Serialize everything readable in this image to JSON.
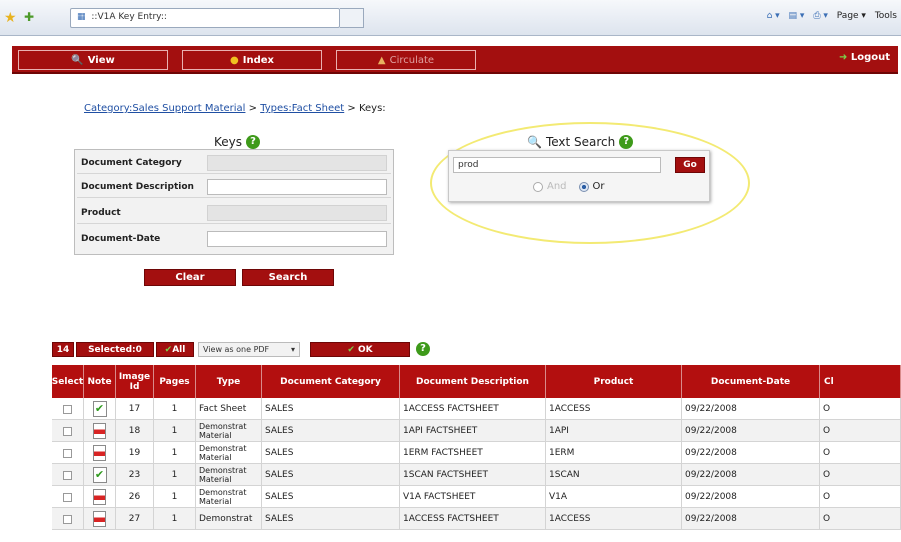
{
  "browser": {
    "tab_title": "::V1A Key Entry::",
    "commands": [
      "Page ▾",
      "Tools"
    ]
  },
  "nav": {
    "view": "View",
    "index": "Index",
    "circulate": "Circulate",
    "logout": "Logout"
  },
  "breadcrumb": {
    "category": "Category:Sales Support Material",
    "sep1": " > ",
    "type": "Types:Fact Sheet",
    "sep2": " > Keys:"
  },
  "keys": {
    "title": "Keys",
    "fields": [
      {
        "label": "Document Category",
        "value": "",
        "disabled": true
      },
      {
        "label": "Document Description",
        "value": "",
        "disabled": false
      },
      {
        "label": "Product",
        "value": "",
        "disabled": true
      },
      {
        "label": "Document-Date",
        "value": "",
        "disabled": false
      }
    ],
    "clear_label": "Clear",
    "search_label": "Search"
  },
  "text_search": {
    "title": "Text Search",
    "query": "prod",
    "go_label": "Go",
    "and_label": "And",
    "or_label": "Or",
    "selected": "or"
  },
  "results_toolbar": {
    "count": "14",
    "selected": "Selected:0",
    "all": "All",
    "view_mode": "View as one PDF",
    "ok": "OK"
  },
  "table": {
    "headers": [
      "Select",
      "Note",
      "Image Id",
      "Pages",
      "Type",
      "Document Category",
      "Document Description",
      "Product",
      "Document-Date",
      "Cl"
    ],
    "rows": [
      {
        "note": "check",
        "image_id": "17",
        "pages": "1",
        "type": "Fact Sheet",
        "category": "SALES",
        "description": "1ACCESS FACTSHEET",
        "product": "1ACCESS",
        "date": "09/22/2008",
        "cl": "O"
      },
      {
        "note": "pdf",
        "image_id": "18",
        "pages": "1",
        "type": "Demonstrat Material",
        "category": "SALES",
        "description": "1API FACTSHEET",
        "product": "1API",
        "date": "09/22/2008",
        "cl": "O"
      },
      {
        "note": "pdf",
        "image_id": "19",
        "pages": "1",
        "type": "Demonstrat Material",
        "category": "SALES",
        "description": "1ERM FACTSHEET",
        "product": "1ERM",
        "date": "09/22/2008",
        "cl": "O"
      },
      {
        "note": "check",
        "image_id": "23",
        "pages": "1",
        "type": "Demonstrat Material",
        "category": "SALES",
        "description": "1SCAN FACTSHEET",
        "product": "1SCAN",
        "date": "09/22/2008",
        "cl": "O"
      },
      {
        "note": "pdf",
        "image_id": "26",
        "pages": "1",
        "type": "Demonstrat Material",
        "category": "SALES",
        "description": "V1A FACTSHEET",
        "product": "V1A",
        "date": "09/22/2008",
        "cl": "O"
      },
      {
        "note": "pdf",
        "image_id": "27",
        "pages": "1",
        "type": "Demonstrat",
        "category": "SALES",
        "description": "1ACCESS FACTSHEET",
        "product": "1ACCESS",
        "date": "09/22/2008",
        "cl": "O"
      }
    ]
  },
  "colors": {
    "brand_red": "#a30f0f",
    "help_green": "#3e9a1a",
    "highlight_ellipse": "#f3ea73"
  }
}
